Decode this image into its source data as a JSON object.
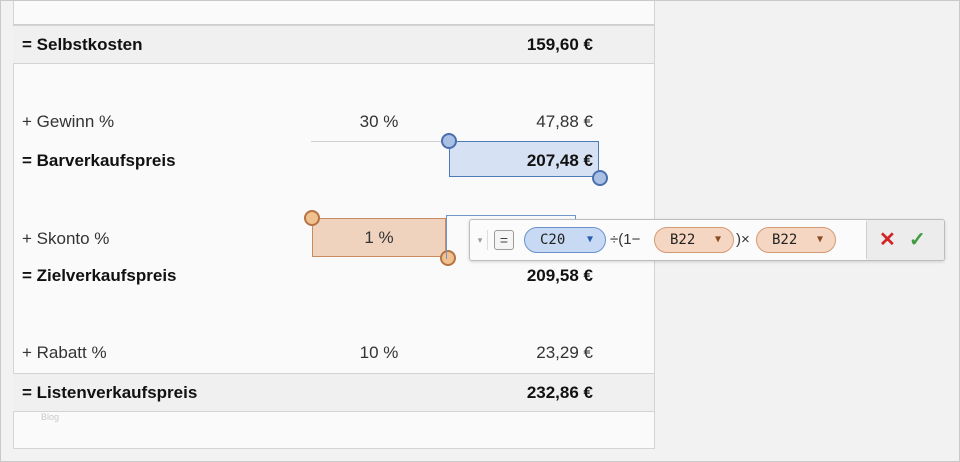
{
  "rows": {
    "selbstkosten": {
      "label": "= Selbstkosten",
      "value": "159,60 €"
    },
    "gewinn": {
      "label": "+ Gewinn %",
      "percent": "30 %",
      "value": "47,88 €"
    },
    "barverkaufspreis": {
      "label": "= Barverkaufspreis",
      "value": "207,48 €"
    },
    "skonto": {
      "label": "+ Skonto %",
      "percent": "1 %"
    },
    "zielverkaufspreis": {
      "label": "= Zielverkaufspreis",
      "value": "209,58 €"
    },
    "rabatt": {
      "label": "+ Rabatt %",
      "percent": "10 %",
      "value": "23,29 €"
    },
    "listenverkaufspreis": {
      "label": "= Listenverkaufspreis",
      "value": "232,86 €"
    }
  },
  "formula_editor": {
    "equals": "=",
    "ref1": "C20",
    "op1": "÷(1−",
    "ref2": "B22",
    "op2": ")×",
    "ref3": "B22",
    "cancel": "✕",
    "accept": "✓"
  },
  "watermark": "Blog",
  "colors": {
    "selection_blue": "#d6e2f3",
    "selection_orange": "#f0d3bf",
    "cancel_red": "#d22424",
    "accept_green": "#3e9b3e"
  }
}
